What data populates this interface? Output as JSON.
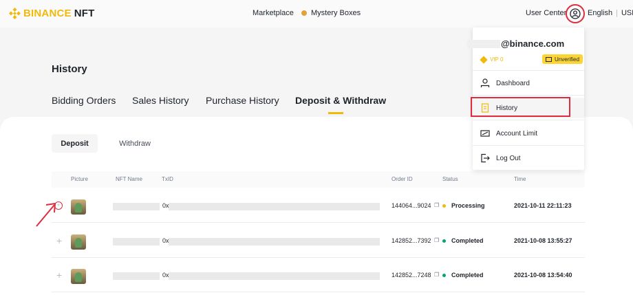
{
  "header": {
    "logo_brand": "BINANCE",
    "logo_suffix": "NFT",
    "nav": {
      "marketplace": "Marketplace",
      "mystery_boxes": "Mystery Boxes",
      "user_center": "User Center"
    },
    "language": "English",
    "currency": "USD"
  },
  "page": {
    "title": "History",
    "tabs": [
      "Bidding Orders",
      "Sales History",
      "Purchase History",
      "Deposit & Withdraw"
    ],
    "active_tab": "Deposit & Withdraw",
    "subtabs": [
      "Deposit",
      "Withdraw"
    ],
    "active_subtab": "Deposit"
  },
  "table": {
    "columns": [
      "Picture",
      "NFT Name",
      "TxID",
      "Order ID",
      "Status",
      "Time"
    ],
    "rows": [
      {
        "txid_prefix": "0x",
        "order_id": "144064...9024",
        "status": "Processing",
        "time": "2021-10-11 22:11:23"
      },
      {
        "txid_prefix": "0x",
        "order_id": "142852...7392",
        "status": "Completed",
        "time": "2021-10-08 13:55:27"
      },
      {
        "txid_prefix": "0x",
        "order_id": "142852...7248",
        "status": "Completed",
        "time": "2021-10-08 13:54:40"
      }
    ]
  },
  "dropdown": {
    "email": "@binance.com",
    "vip": "VIP 0",
    "verification": "Unverified",
    "items": [
      "Dashboard",
      "History",
      "Account Limit",
      "Log Out"
    ]
  },
  "colors": {
    "brand_yellow": "#f0b90b",
    "annotation_red": "#e02b3c",
    "processing": "#f0b90b",
    "completed": "#03a66d"
  }
}
